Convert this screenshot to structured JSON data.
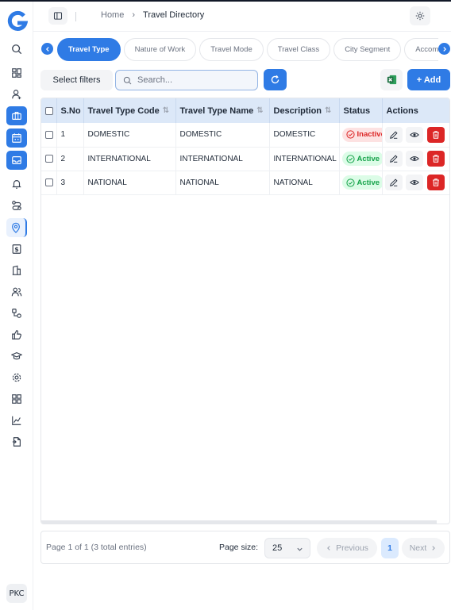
{
  "app": {
    "logo_letter": "G",
    "user_initials": "PKC"
  },
  "header": {
    "breadcrumb_home": "Home",
    "breadcrumb_current": "Travel Directory"
  },
  "sidebar": {
    "items": [
      {
        "icon": "search-icon"
      },
      {
        "icon": "dashboard-icon"
      },
      {
        "icon": "user-add-icon"
      },
      {
        "icon": "briefcase-icon"
      },
      {
        "icon": "calendar-icon"
      },
      {
        "icon": "inbox-icon"
      },
      {
        "icon": "bell-icon"
      },
      {
        "icon": "route-icon"
      },
      {
        "icon": "location-pin-icon"
      },
      {
        "icon": "dollar-icon"
      },
      {
        "icon": "building-icon"
      },
      {
        "icon": "users-icon"
      },
      {
        "icon": "workflow-icon"
      },
      {
        "icon": "thumbs-up-icon"
      },
      {
        "icon": "graduation-cap-icon"
      },
      {
        "icon": "settings-icon"
      },
      {
        "icon": "apps-icon"
      },
      {
        "icon": "chart-icon"
      },
      {
        "icon": "document-icon"
      }
    ]
  },
  "tabs": [
    {
      "label": "Travel Type",
      "active": true
    },
    {
      "label": "Nature of Work",
      "active": false
    },
    {
      "label": "Travel Mode",
      "active": false
    },
    {
      "label": "Travel Class",
      "active": false
    },
    {
      "label": "City Segment",
      "active": false
    },
    {
      "label": "Accommodation",
      "active": false
    }
  ],
  "toolbar": {
    "filter_label": "Select filters",
    "search_placeholder": "Search...",
    "add_label": "+ Add"
  },
  "table": {
    "columns": [
      "S.No",
      "Travel Type Code",
      "Travel Type Name",
      "Description",
      "Status",
      "Actions"
    ],
    "rows": [
      {
        "sno": "1",
        "code": "DOMESTIC",
        "name": "DOMESTIC",
        "description": "DOMESTIC",
        "status": "Inactive"
      },
      {
        "sno": "2",
        "code": "INTERNATIONAL",
        "name": "INTERNATIONAL",
        "description": "INTERNATIONAL",
        "status": "Active"
      },
      {
        "sno": "3",
        "code": "NATIONAL",
        "name": "NATIONAL",
        "description": "NATIONAL",
        "status": "Active"
      }
    ]
  },
  "footer": {
    "page_info": "Page 1 of 1 (3 total entries)",
    "page_size_label": "Page size:",
    "page_size_value": "25",
    "prev_label": "Previous",
    "current_page": "1",
    "next_label": "Next"
  },
  "colors": {
    "accent": "#2f7be5",
    "danger": "#dc2626",
    "success": "#16a34a"
  }
}
